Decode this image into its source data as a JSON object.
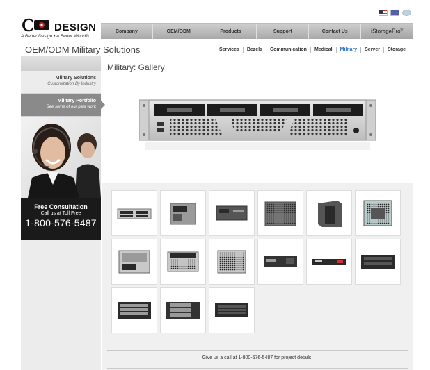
{
  "flags": [
    {
      "icon": "us-flag-icon"
    },
    {
      "icon": "eu-flag-icon"
    },
    {
      "icon": "language-flag-icon"
    }
  ],
  "logo": {
    "word": "DESIGN",
    "tagline": "A Better Design • A Better World®"
  },
  "topnav": {
    "items": [
      "Company",
      "OEM/ODM",
      "Products",
      "Support",
      "Contact Us"
    ],
    "istorage": {
      "prefix": "i",
      "rest": "StoragePro",
      "suffix": "®"
    }
  },
  "page": {
    "title": "OEM/ODM Military Solutions",
    "subnav": [
      "Services",
      "Bezels",
      "Communication",
      "Medical",
      "Military",
      "Server",
      "Storage"
    ],
    "subnav_active": "Military"
  },
  "sidebar": {
    "items": [
      {
        "title": "Military Solutions",
        "subtitle": "Customization By Industry"
      },
      {
        "title": "Military Portfolio",
        "subtitle": "See some of our past work"
      }
    ],
    "consult": {
      "title": "Free Consultation",
      "line": "Call us at Toll Free",
      "phone": "1-800-576-5487"
    }
  },
  "main": {
    "title": "Military: Gallery",
    "thumbnails": [
      {
        "kind": "1u-drives"
      },
      {
        "kind": "tower-box"
      },
      {
        "kind": "1u-panel"
      },
      {
        "kind": "mesh-box"
      },
      {
        "kind": "tower-black"
      },
      {
        "kind": "open-cage"
      },
      {
        "kind": "open-chassis"
      },
      {
        "kind": "mesh-front"
      },
      {
        "kind": "mesh-front-2"
      },
      {
        "kind": "rack-1u"
      },
      {
        "kind": "rack-thin"
      },
      {
        "kind": "rack-2u"
      },
      {
        "kind": "rack-bays"
      },
      {
        "kind": "rack-bays-2"
      },
      {
        "kind": "rack-3u"
      }
    ],
    "footer_text": "Give us a call at 1-800-576-5487 for project details."
  },
  "colors": {
    "accent": "#2f74c0",
    "nav_bg": "#b8b8b8",
    "sidebar_active": "#8a8a8a",
    "consult_bg": "#1a1a1a"
  }
}
